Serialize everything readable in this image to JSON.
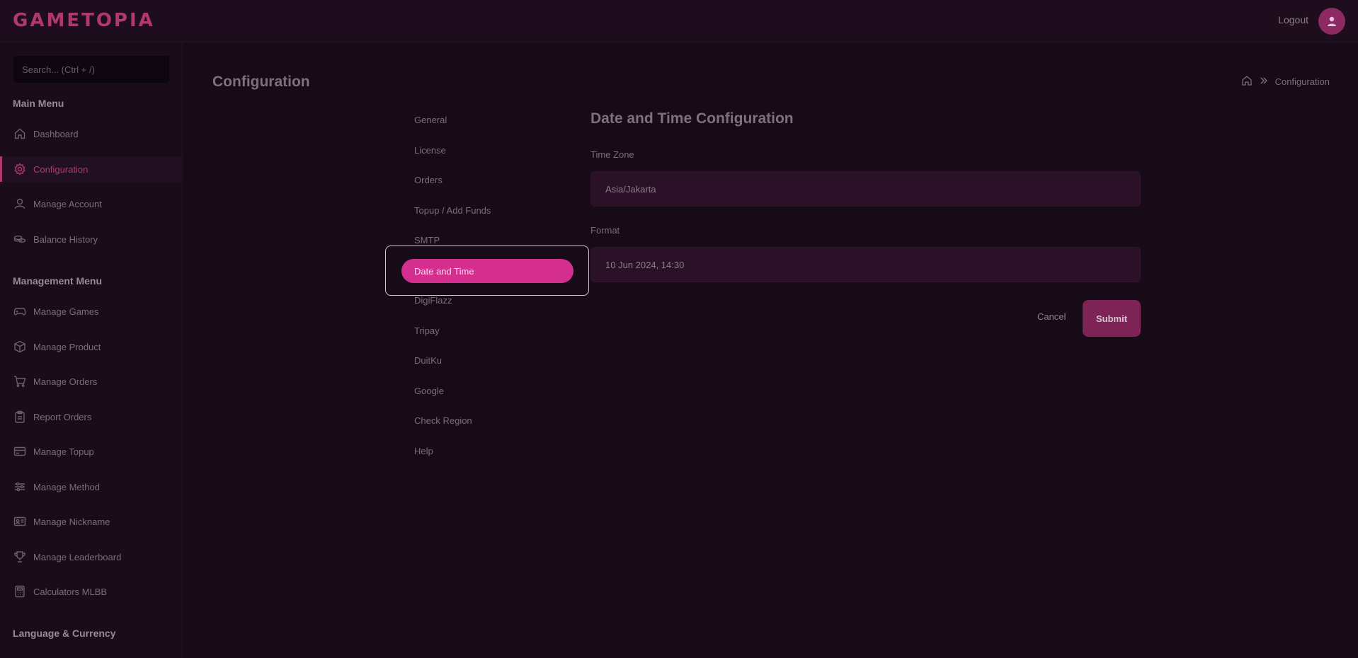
{
  "app": {
    "logo": "GAMETOPIA",
    "logout_label": "Logout"
  },
  "sidebar": {
    "search_placeholder": "Search... (Ctrl + /)",
    "main_menu_heading": "Main Menu",
    "main_items": [
      {
        "label": "Dashboard",
        "icon": "home-icon"
      },
      {
        "label": "Configuration",
        "icon": "gear-icon",
        "active": true
      },
      {
        "label": "Manage Account",
        "icon": "user-icon"
      },
      {
        "label": "Balance History",
        "icon": "coins-icon"
      }
    ],
    "management_heading": "Management Menu",
    "management_items": [
      {
        "label": "Manage Games",
        "icon": "gamepad-icon"
      },
      {
        "label": "Manage Product",
        "icon": "box-icon"
      },
      {
        "label": "Manage Orders",
        "icon": "cart-icon"
      },
      {
        "label": "Report Orders",
        "icon": "clipboard-icon"
      },
      {
        "label": "Manage Topup",
        "icon": "card-icon"
      },
      {
        "label": "Manage Method",
        "icon": "sliders-icon"
      },
      {
        "label": "Manage Nickname",
        "icon": "id-card-icon"
      },
      {
        "label": "Manage Leaderboard",
        "icon": "trophy-icon"
      },
      {
        "label": "Calculators MLBB",
        "icon": "calculator-icon"
      }
    ],
    "language_heading": "Language & Currency"
  },
  "header": {
    "page_title": "Configuration",
    "breadcrumb_current": "Configuration"
  },
  "subnav": {
    "items": [
      "General",
      "License",
      "Orders",
      "Topup / Add Funds",
      "SMTP",
      "Date and Time",
      "DigiFlazz",
      "Tripay",
      "DuitKu",
      "Google",
      "Check Region",
      "Help"
    ],
    "active": "Date and Time"
  },
  "form": {
    "title": "Date and Time Configuration",
    "timezone_label": "Time Zone",
    "timezone_value": "Asia/Jakarta",
    "format_label": "Format",
    "format_value": "10 Jun 2024, 14:30",
    "cancel_label": "Cancel",
    "submit_label": "Submit"
  },
  "colors": {
    "accent": "#d42e8f",
    "brand": "#b1386f",
    "background": "#170b17"
  }
}
